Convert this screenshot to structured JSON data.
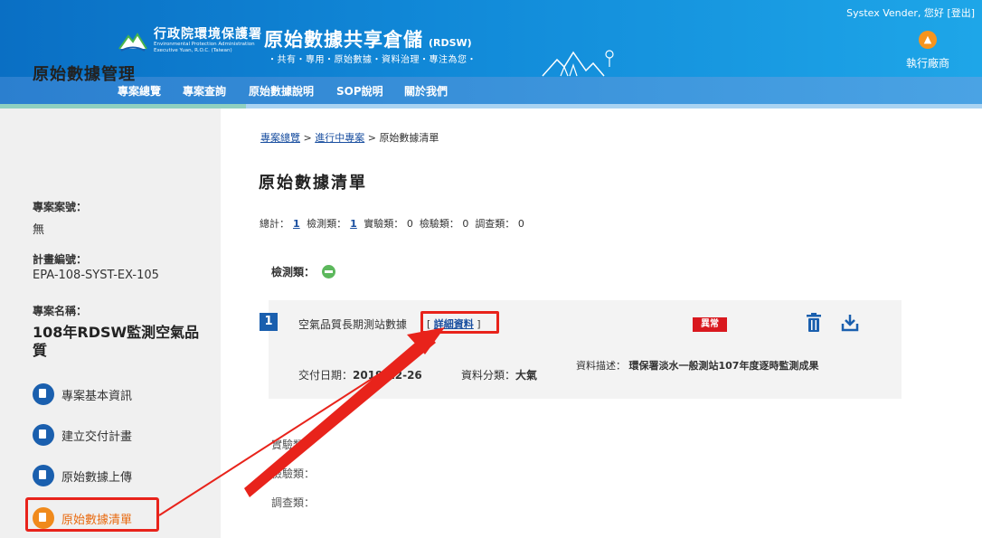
{
  "header": {
    "org_zh": "行政院環境保護署",
    "org_en1": "Environmental Protection Administration",
    "org_en2": "Executive Yuan, R.O.C. (Taiwan)",
    "site_title": "原始數據共享倉儲",
    "site_abbr": "(RDSW)",
    "site_subtitle": "・共有・專用・原始數據・資料治理・專注為您・",
    "user_greeting": "Systex Vender, 您好 [",
    "logout": "登出",
    "user_greeting_end": "]",
    "vendor_label": "執行廠商",
    "vendor_icon": "building-icon"
  },
  "nav": {
    "items": [
      "專案總覽",
      "專案查詢",
      "原始數據說明",
      "SOP說明",
      "關於我們"
    ]
  },
  "sidebar": {
    "title": "原始數據管理",
    "case_no_label": "專案案號：",
    "case_no_value": "無",
    "plan_no_label": "計畫編號：",
    "plan_no_value": "EPA-108-SYST-EX-105",
    "name_label": "專案名稱：",
    "name_value": "108年RDSW監測空氣品質",
    "menu": [
      {
        "label": "專案基本資訊",
        "active": false
      },
      {
        "label": "建立交付計畫",
        "active": false
      },
      {
        "label": "原始數據上傳",
        "active": false
      },
      {
        "label": "原始數據清單",
        "active": true
      }
    ]
  },
  "breadcrumb": {
    "crumb1": "專案總覽",
    "sep": ">",
    "crumb2": "進行中專案",
    "current": "原始數據清單"
  },
  "main": {
    "title": "原始數據清單",
    "summary": {
      "total_label": "總計：",
      "total": "1",
      "detect_label": "檢測類：",
      "detect": "1",
      "experiment_label": "實驗類：",
      "experiment": "0",
      "inspect_label": "檢驗類：",
      "inspect": "0",
      "survey_label": "調查類：",
      "survey": "0"
    },
    "category_detect": "檢測類：",
    "record": {
      "index": "1",
      "name": "空氣品質長期測站數據",
      "detail_open": "[",
      "detail_link": "詳細資料",
      "detail_close": "]",
      "status": "異常",
      "delivery_label": "交付日期：",
      "delivery_date": "2019-12-26",
      "class_label": "資料分類：",
      "class_value": "大氣",
      "desc_label": "資料描述：",
      "desc_value": "環保署淡水一般測站107年度逐時監測成果"
    },
    "category_experiment": "實驗類：",
    "category_inspect": "檢驗類：",
    "category_survey": "調查類："
  },
  "colors": {
    "header_blue": "#0a6fc4",
    "nav_blue": "#2b7fcf",
    "highlight_red": "#e8231b",
    "status_red": "#d9181e",
    "link_blue": "#1a4fa0",
    "active_orange": "#f08a1c"
  }
}
